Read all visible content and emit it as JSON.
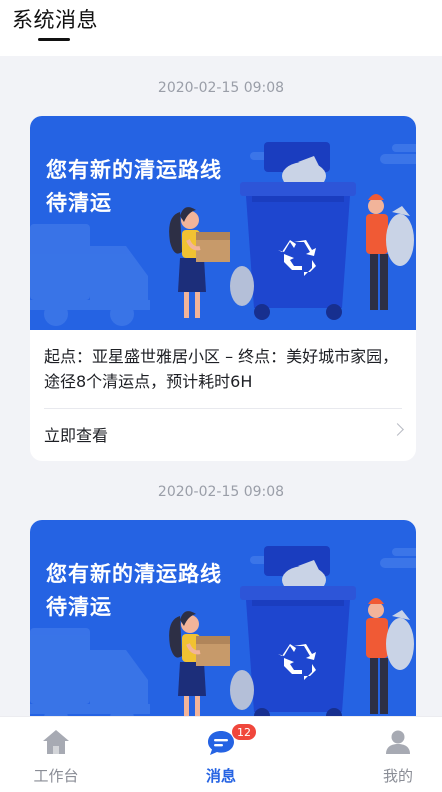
{
  "header": {
    "title": "系统消息"
  },
  "messages": [
    {
      "timestamp": "2020-02-15 09:08",
      "banner_line1": "您有新的清运路线",
      "banner_line2": "待清运",
      "info": "起点：亚星盛世雅居小区 – 终点：美好城市家园，途径8个清运点，预计耗时6H",
      "action_label": "立即查看"
    },
    {
      "timestamp": "2020-02-15 09:08",
      "banner_line1": "您有新的清运路线",
      "banner_line2": "待清运"
    }
  ],
  "tabs": [
    {
      "label": "工作台",
      "icon": "home-icon",
      "active": false
    },
    {
      "label": "消息",
      "icon": "chat-icon",
      "active": true,
      "badge": "12"
    },
    {
      "label": "我的",
      "icon": "user-icon",
      "active": false
    }
  ],
  "colors": {
    "accent": "#2563e3",
    "badge": "#f0473c",
    "banner_bg": "#2563e3"
  }
}
